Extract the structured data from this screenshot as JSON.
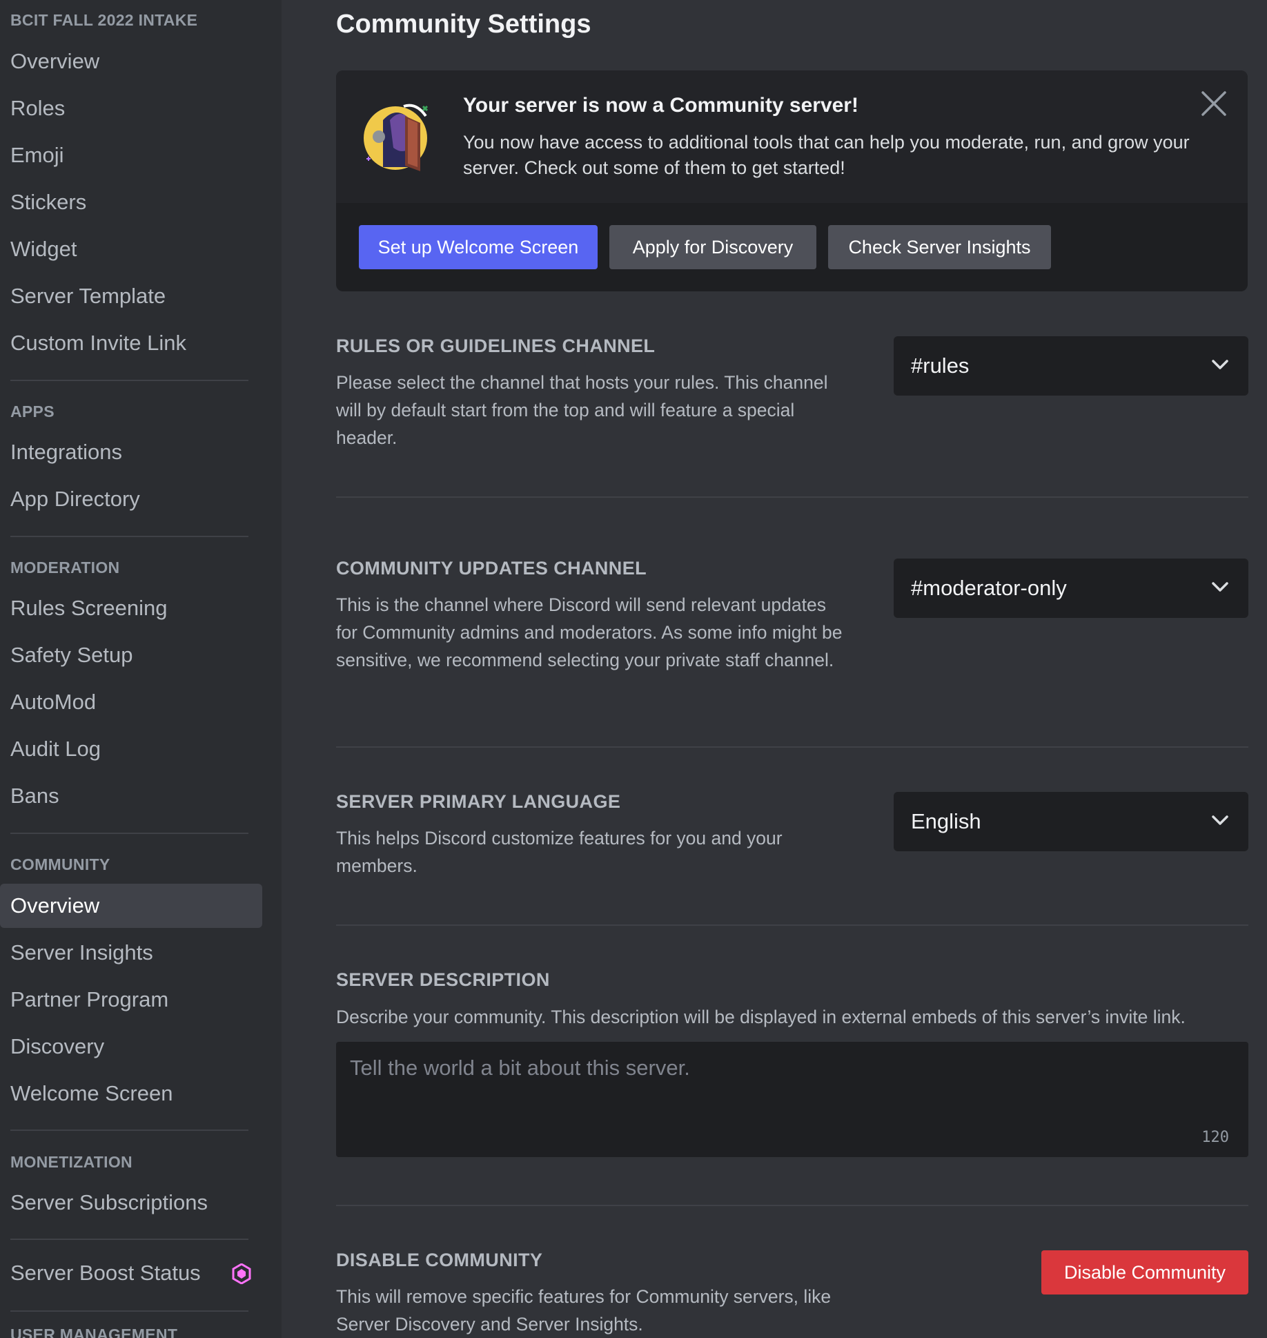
{
  "sidebar": {
    "server_header": "BCIT FALL 2022 INTAKE",
    "server_items": [
      "Overview",
      "Roles",
      "Emoji",
      "Stickers",
      "Widget",
      "Server Template",
      "Custom Invite Link"
    ],
    "apps_header": "APPS",
    "apps_items": [
      "Integrations",
      "App Directory"
    ],
    "moderation_header": "MODERATION",
    "moderation_items": [
      "Rules Screening",
      "Safety Setup",
      "AutoMod",
      "Audit Log",
      "Bans"
    ],
    "community_header": "COMMUNITY",
    "community_items": [
      "Overview",
      "Server Insights",
      "Partner Program",
      "Discovery",
      "Welcome Screen"
    ],
    "community_selected": "Overview",
    "monetization_header": "MONETIZATION",
    "monetization_items": [
      "Server Subscriptions"
    ],
    "boost_label": "Server Boost Status",
    "boost_icon": "nitro-boost-gem-icon",
    "user_management_header": "USER MANAGEMENT"
  },
  "main": {
    "title": "Community Settings",
    "banner": {
      "title": "Your server is now a Community server!",
      "text": "You now have access to additional tools that can help you moderate, run, and grow your server. Check out some of them to get started!",
      "buttons": [
        "Set up Welcome Screen",
        "Apply for Discovery",
        "Check Server Insights"
      ],
      "close_icon": "close-icon"
    },
    "rules_channel": {
      "title": "RULES OR GUIDELINES CHANNEL",
      "description": "Please select the channel that hosts your rules. This channel will by default start from the top and will feature a special header.",
      "value": "#rules"
    },
    "updates_channel": {
      "title": "COMMUNITY UPDATES CHANNEL",
      "description": "This is the channel where Discord will send relevant updates for Community admins and moderators. As some info might be sensitive, we recommend selecting your private staff channel.",
      "value": "#moderator-only"
    },
    "primary_language": {
      "title": "SERVER PRIMARY LANGUAGE",
      "description": "This helps Discord customize features for you and your members.",
      "value": "English"
    },
    "server_description": {
      "title": "SERVER DESCRIPTION",
      "description": "Describe your community. This description will be displayed in external embeds of this server’s invite link.",
      "placeholder": "Tell the world a bit about this server.",
      "char_count": "120"
    },
    "disable_community": {
      "title": "DISABLE COMMUNITY",
      "description": "This will remove specific features for Community servers, like Server Discovery and Server Insights.",
      "button": "Disable Community"
    }
  },
  "colors": {
    "sidebar_bg": "#2b2d31",
    "main_bg": "#313338",
    "input_bg": "#1e1f22",
    "brand": "#5865f2",
    "danger": "#da373c",
    "selected_item": "#404249",
    "boost_pink": "#ff73fa"
  }
}
